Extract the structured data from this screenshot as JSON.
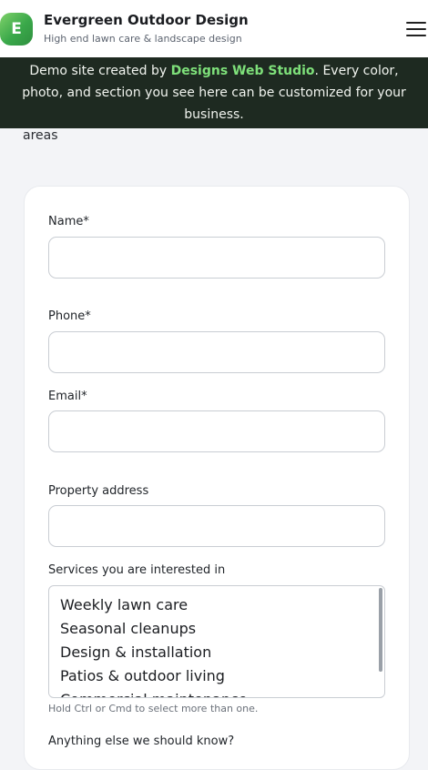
{
  "header": {
    "logo_letter": "E",
    "title": "Evergreen Outdoor Design",
    "tagline": "High end lawn care & landscape design"
  },
  "banner": {
    "prefix": "Demo site created by ",
    "studio": "Designs Web Studio",
    "suffix": ". Every color, photo, and section you see here can be customized for your business."
  },
  "intro": {
    "trailing_text": "areas"
  },
  "form": {
    "name_label": "Name*",
    "phone_label": "Phone*",
    "email_label": "Email*",
    "address_label": "Property address",
    "services_label": "Services you are interested in",
    "services_options": [
      "Weekly lawn care",
      "Seasonal cleanups",
      "Design & installation",
      "Patios & outdoor living",
      "Commercial maintenance"
    ],
    "services_hint": "Hold Ctrl or Cmd to select more than one.",
    "notes_label": "Anything else we should know?"
  }
}
